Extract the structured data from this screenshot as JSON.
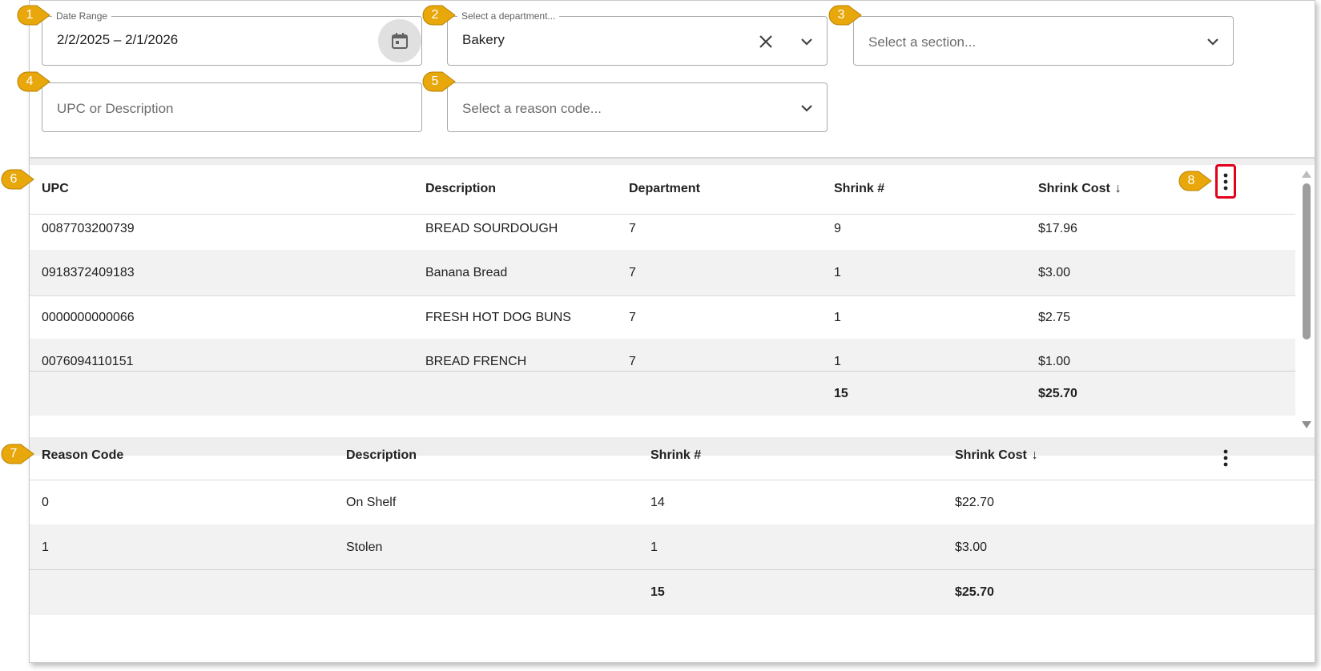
{
  "filters": {
    "date_range": {
      "label": "Date Range",
      "value": "2/2/2025 – 2/1/2026"
    },
    "department": {
      "label": "Select a department...",
      "value": "Bakery"
    },
    "section": {
      "placeholder": "Select a section..."
    },
    "upc_search": {
      "placeholder": "UPC or Description"
    },
    "reason_code": {
      "placeholder": "Select a reason code..."
    }
  },
  "items_table": {
    "columns": [
      "UPC",
      "Description",
      "Department",
      "Shrink #",
      "Shrink Cost"
    ],
    "sort_indicator": "↓",
    "rows": [
      [
        "0087703200739",
        "BREAD SOURDOUGH",
        "7",
        "9",
        "$17.96"
      ],
      [
        "0918372409183",
        "Banana Bread",
        "7",
        "1",
        "$3.00"
      ],
      [
        "0000000000066",
        "FRESH HOT DOG BUNS",
        "7",
        "1",
        "$2.75"
      ],
      [
        "0076094110151",
        "BREAD FRENCH",
        "7",
        "1",
        "$1.00"
      ]
    ],
    "totals": {
      "shrink_count": "15",
      "shrink_cost": "$25.70"
    }
  },
  "reasons_table": {
    "columns": [
      "Reason Code",
      "Description",
      "Shrink #",
      "Shrink Cost"
    ],
    "sort_indicator": "↓",
    "rows": [
      [
        "0",
        "On Shelf",
        "14",
        "$22.70"
      ],
      [
        "1",
        "Stolen",
        "1",
        "$3.00"
      ]
    ],
    "totals": {
      "shrink_count": "15",
      "shrink_cost": "$25.70"
    }
  },
  "callouts": [
    "1",
    "2",
    "3",
    "4",
    "5",
    "6",
    "7",
    "8"
  ],
  "colors": {
    "callout": "#e8a70a",
    "highlight": "#e2001a",
    "alt_row": "#f2f2f2"
  },
  "icons": [
    "calendar-icon",
    "clear-icon",
    "chevron-down-icon",
    "more-vert-icon",
    "sort-down-icon"
  ]
}
